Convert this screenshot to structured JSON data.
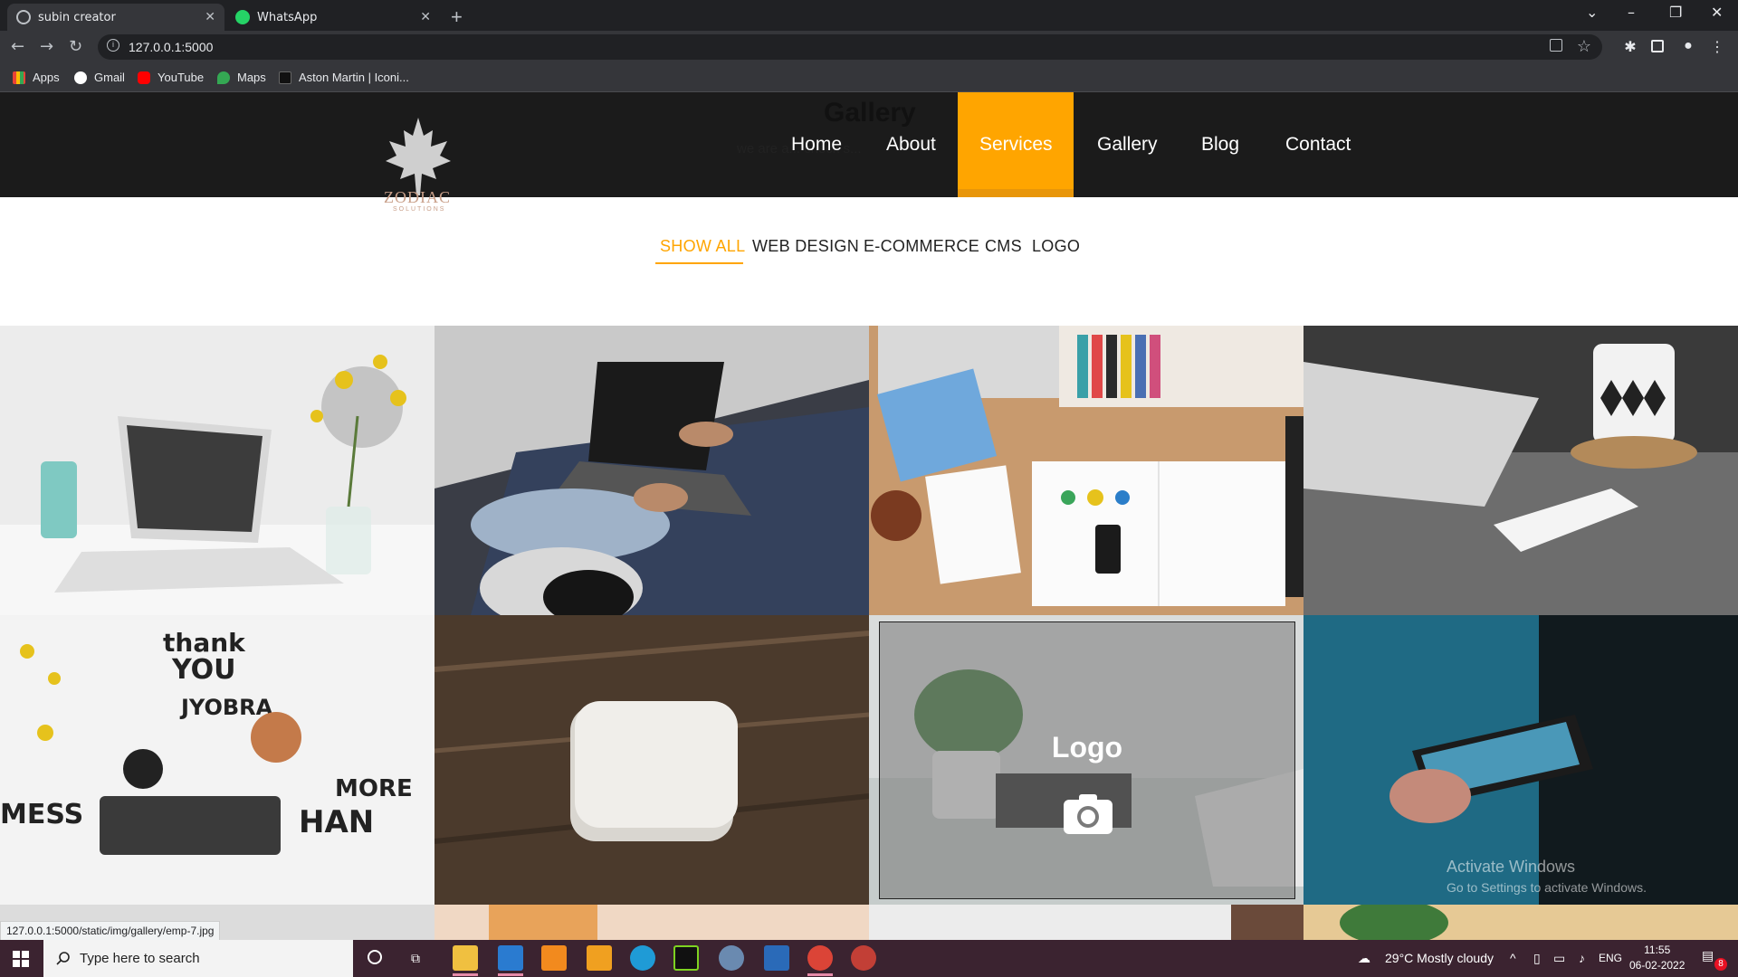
{
  "browser": {
    "tabs": [
      {
        "title": "subin creator",
        "icon": "globe-icon"
      },
      {
        "title": "WhatsApp",
        "icon": "whatsapp-icon"
      }
    ],
    "url": "127.0.0.1:5000",
    "bookmarks": [
      {
        "label": "Apps",
        "icon": "apps-grid-icon"
      },
      {
        "label": "Gmail",
        "icon": "google-icon"
      },
      {
        "label": "YouTube",
        "icon": "youtube-icon"
      },
      {
        "label": "Maps",
        "icon": "maps-icon"
      },
      {
        "label": "Aston Martin | Iconi...",
        "icon": "aston-martin-icon"
      }
    ]
  },
  "site": {
    "hidden_heading": "Gallery",
    "hidden_subtitle": "we are a... check s...",
    "logo_text": "ZODIAC",
    "logo_sub": "SOLUTIONS",
    "nav": [
      "Home",
      "About",
      "Services",
      "Gallery",
      "Blog",
      "Contact"
    ],
    "active_nav": "Services",
    "accent_color": "#ffa500"
  },
  "filters": {
    "items": [
      "SHOW ALL",
      "WEB DESIGN",
      "E-COMMERCE",
      "CMS",
      "LOGO"
    ],
    "active": "SHOW ALL"
  },
  "gallery": {
    "hover_title": "Logo",
    "hover_icon": "camera-icon"
  },
  "status_link": "127.0.0.1:5000/static/img/gallery/emp-7.jpg",
  "watermark": {
    "line1": "Activate Windows",
    "line2": "Go to Settings to activate Windows."
  },
  "taskbar": {
    "search_placeholder": "Type here to search",
    "weather": "29°C  Mostly cloudy",
    "language": "ENG",
    "time": "11:55",
    "date": "06-02-2022",
    "notification_count": "8"
  }
}
